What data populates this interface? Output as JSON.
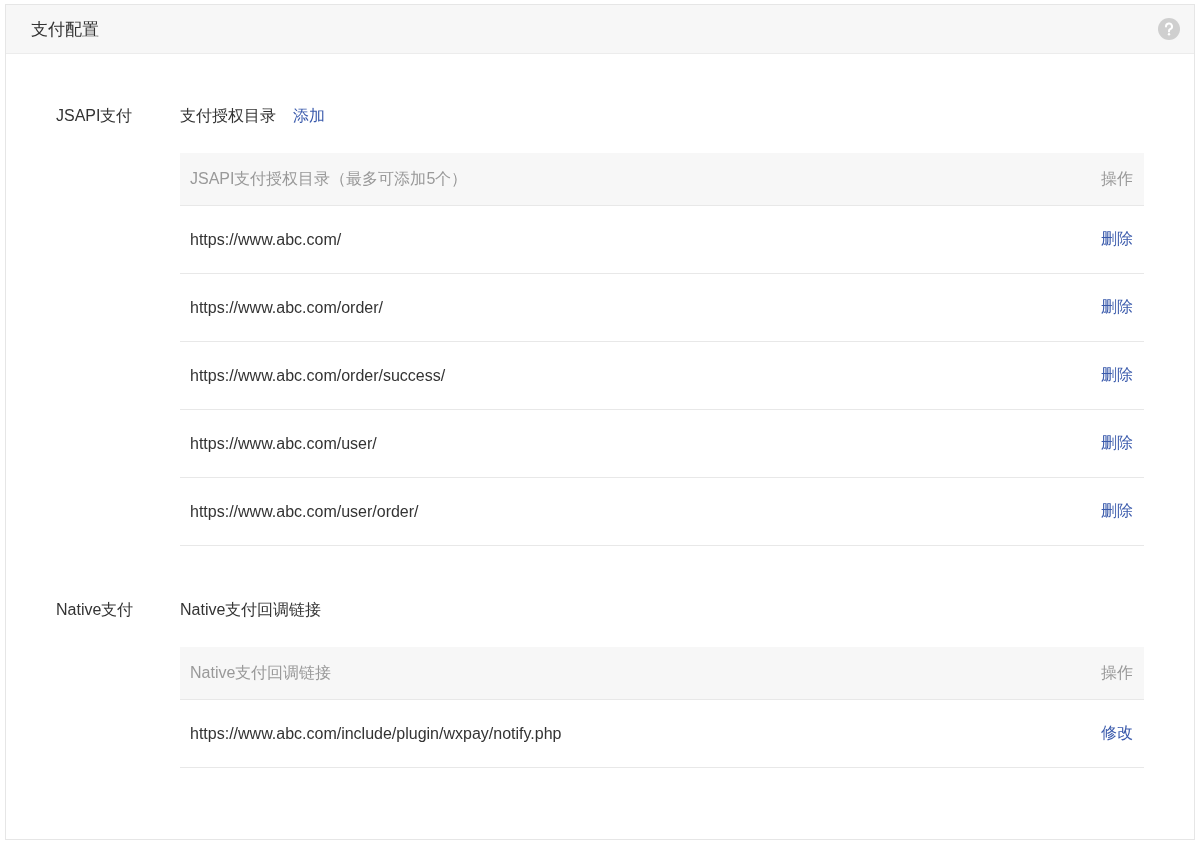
{
  "panel": {
    "title": "支付配置"
  },
  "sections": [
    {
      "label": "JSAPI支付",
      "heading": "支付授权目录",
      "heading_action": "添加",
      "table": {
        "columns": [
          "JSAPI支付授权目录（最多可添加5个）",
          "操作"
        ],
        "rows": [
          {
            "url": "https://www.abc.com/",
            "action": "删除"
          },
          {
            "url": "https://www.abc.com/order/",
            "action": "删除"
          },
          {
            "url": "https://www.abc.com/order/success/",
            "action": "删除"
          },
          {
            "url": "https://www.abc.com/user/",
            "action": "删除"
          },
          {
            "url": "https://www.abc.com/user/order/",
            "action": "删除"
          }
        ]
      }
    },
    {
      "label": "Native支付",
      "heading": "Native支付回调链接",
      "table": {
        "columns": [
          "Native支付回调链接",
          "操作"
        ],
        "rows": [
          {
            "url": "https://www.abc.com/include/plugin/wxpay/notify.php",
            "action": "修改"
          }
        ]
      }
    }
  ]
}
